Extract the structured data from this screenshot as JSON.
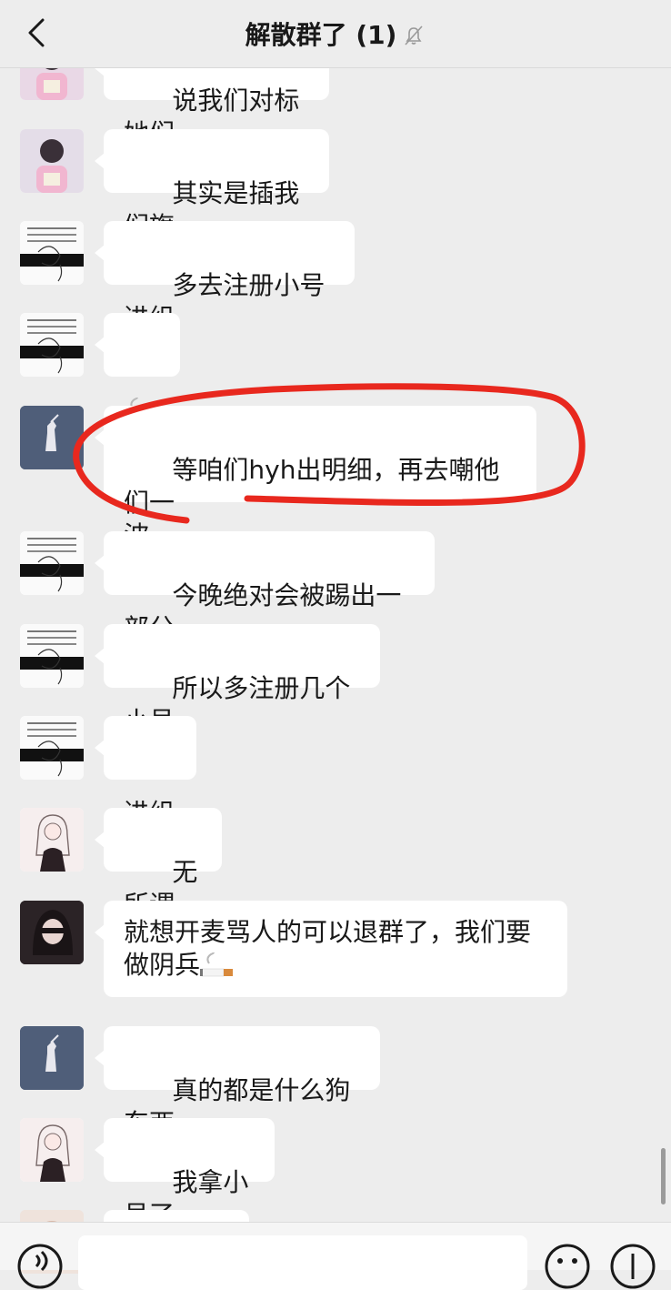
{
  "header": {
    "title": "解散群了 (1)",
    "back_icon": "chevron-left-icon",
    "mute_icon": "bell-off-icon"
  },
  "messages": [
    {
      "avatar": "avatar-anime-girl-pink",
      "text": "说我们对标她们"
    },
    {
      "avatar": "avatar-anime-girl-pink",
      "text": "其实是插我们旗"
    },
    {
      "avatar": "avatar-shes-someones-text",
      "avatar_text": "SHE'S SOMEONE'S SISTER/MOTHER/ DAUGHTER/WIFE",
      "text": "多去注册小号进组"
    },
    {
      "avatar": "avatar-shes-someones-text",
      "avatar_text": "SHE'S SOMEONE'S SISTER/MOTHER/ DAUGHTER/WIFE",
      "text": "",
      "emoji": "cigarette-emoji"
    },
    {
      "avatar": "avatar-dark-blue-figure",
      "text": "等咱们hyh出明细，再去嘲他们一\n波，",
      "highlighted": true
    },
    {
      "avatar": "avatar-shes-someones-text",
      "avatar_text": "SHE'S SOMEONE'S SISTER/MOTHER/ DAUGHTER/WIFE",
      "text": "今晚绝对会被踢出一部分"
    },
    {
      "avatar": "avatar-shes-someones-text",
      "avatar_text": "SHE'S SOMEONE'S SISTER/MOTHER/ DAUGHTER/WIFE",
      "text": "所以多注册几个小号"
    },
    {
      "avatar": "avatar-shes-someones-text",
      "avatar_text": "SHE'S SOMEONE'S SISTER/MOTHER/ DAUGHTER/WIFE",
      "text": "进组"
    },
    {
      "avatar": "avatar-sketch-girl",
      "text": "无所谓"
    },
    {
      "avatar": "avatar-dark-anime-girl",
      "text": "就想开麦骂人的可以退群了，我们要\n做阴兵",
      "emoji": "cigarette-emoji"
    },
    {
      "avatar": "avatar-dark-blue-figure",
      "text": "真的都是什么狗东西"
    },
    {
      "avatar": "avatar-sketch-girl",
      "text": "我拿小号了"
    }
  ],
  "highlight_color": "#e8281e",
  "bottom_bar": {
    "voice_icon": "voice-icon",
    "emoji_icon": "smiley-icon",
    "add_icon": "plus-circle-icon"
  }
}
